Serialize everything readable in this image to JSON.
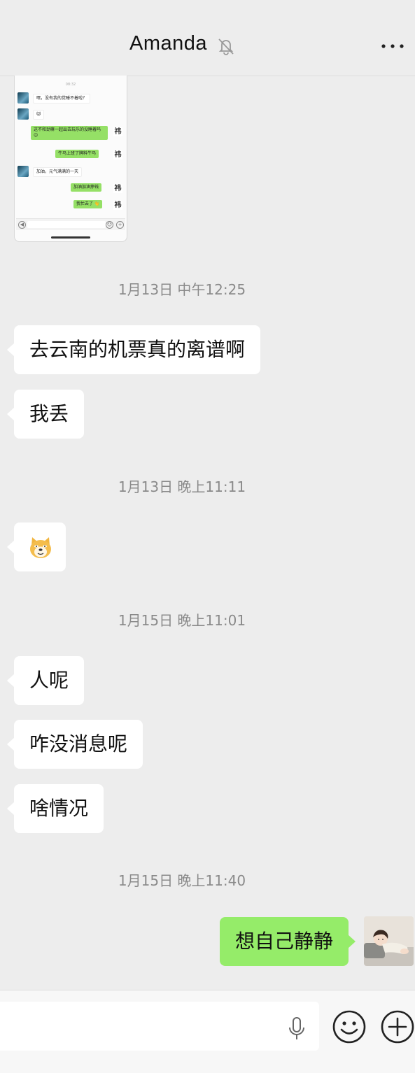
{
  "header": {
    "title": "Amanda",
    "mute_icon": "bell-off-icon",
    "more_icon": "more-dots-icon"
  },
  "embedded_screenshot": {
    "time": "08:32",
    "messages": [
      {
        "side": "left",
        "text": "嘿，没有我的觉睡不着啦？"
      },
      {
        "side": "left",
        "text": "🐱"
      },
      {
        "side": "right",
        "text": "这不和劲嘛一起出去玩乐的没睡着吗 😊"
      },
      {
        "side": "right",
        "text": "牛马上班了牌料牛马"
      },
      {
        "side": "left",
        "text": "加油，元气满满的一天"
      },
      {
        "side": "right",
        "text": "加油加油挣钱"
      },
      {
        "side": "right",
        "text": "我忙去了 👋"
      }
    ],
    "right_avatar_text": "祎"
  },
  "messages": [
    {
      "type": "time",
      "text": "1月13日 中午12:25"
    },
    {
      "type": "in",
      "text": "去云南的机票真的离谱啊"
    },
    {
      "type": "in",
      "text": "我丢"
    },
    {
      "type": "time",
      "text": "1月13日 晚上11:11"
    },
    {
      "type": "in-emoji",
      "icon": "doge-emoji-icon"
    },
    {
      "type": "time",
      "text": "1月15日 晚上11:01"
    },
    {
      "type": "in",
      "text": "人呢"
    },
    {
      "type": "in",
      "text": "咋没消息呢"
    },
    {
      "type": "in",
      "text": "啥情况"
    },
    {
      "type": "time",
      "text": "1月15日 晚上11:40"
    },
    {
      "type": "out",
      "text": "想自己静静"
    }
  ],
  "input_bar": {
    "icons": [
      "microphone-icon",
      "emoji-icon",
      "plus-icon"
    ]
  },
  "colors": {
    "background": "#ededed",
    "incoming_bubble": "#ffffff",
    "outgoing_bubble": "#95ec69",
    "timestamp_text": "#8a8a8a"
  }
}
